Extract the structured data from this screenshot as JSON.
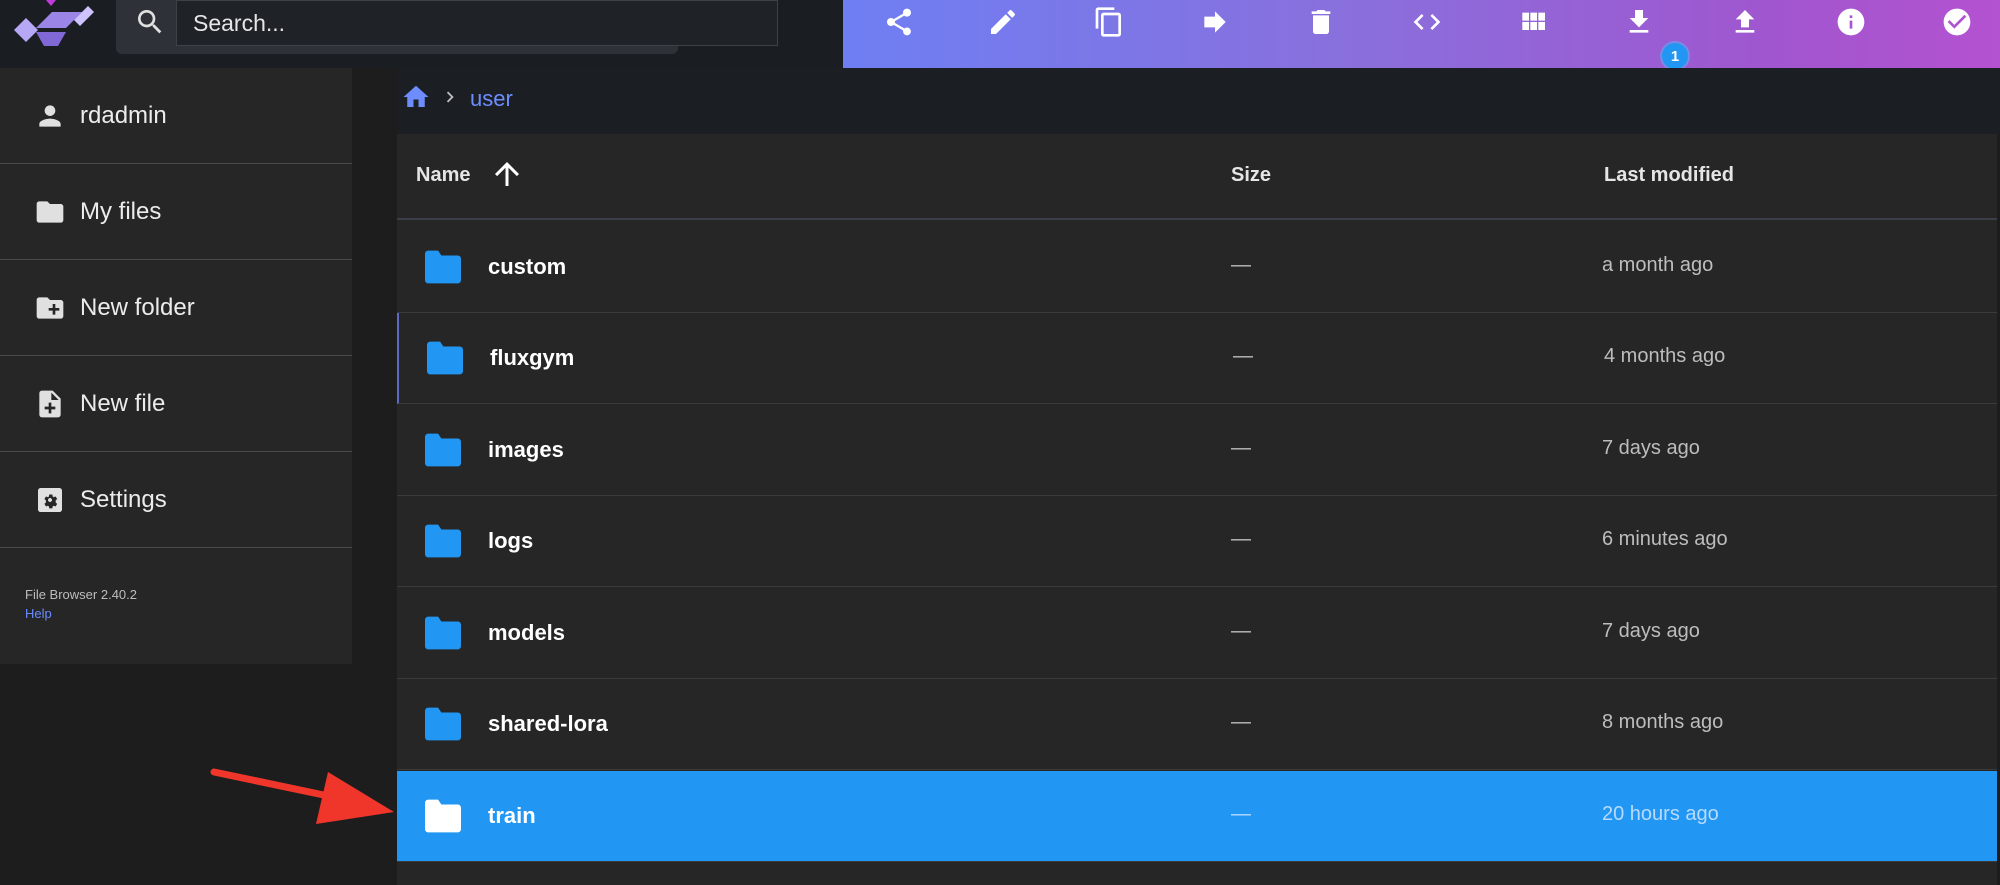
{
  "app": {
    "version": "File Browser 2.40.2",
    "help": "Help"
  },
  "search": {
    "placeholder": "Search..."
  },
  "toolbar": {
    "actions": [
      "share-icon",
      "edit-icon",
      "copy-icon",
      "move-icon",
      "delete-icon",
      "embed-code-icon",
      "grid-view-icon",
      "download-icon",
      "upload-icon",
      "info-icon",
      "select-all-icon"
    ],
    "download_badge": "1",
    "gradient": [
      "#6e7ff3",
      "#b452d0"
    ]
  },
  "sidebar": {
    "items": [
      {
        "label": "rdadmin",
        "icon": "person-icon"
      },
      {
        "label": "My files",
        "icon": "folder-icon"
      },
      {
        "label": "New folder",
        "icon": "new-folder-icon"
      },
      {
        "label": "New file",
        "icon": "new-file-icon"
      },
      {
        "label": "Settings",
        "icon": "settings-icon"
      }
    ]
  },
  "breadcrumb": {
    "home": "home-icon",
    "current": "user"
  },
  "listing": {
    "columns": {
      "name": "Name",
      "size": "Size",
      "modified": "Last modified"
    },
    "rows": [
      {
        "name": "custom",
        "size": "—",
        "modified": "a month ago"
      },
      {
        "name": "fluxgym",
        "size": "—",
        "modified": "4 months ago"
      },
      {
        "name": "images",
        "size": "—",
        "modified": "7 days ago"
      },
      {
        "name": "logs",
        "size": "—",
        "modified": "6 minutes ago"
      },
      {
        "name": "models",
        "size": "—",
        "modified": "7 days ago"
      },
      {
        "name": "shared-lora",
        "size": "—",
        "modified": "8 months ago"
      },
      {
        "name": "train",
        "size": "—",
        "modified": "20 hours ago",
        "selected": true
      }
    ]
  },
  "colors": {
    "accent": "#2196f3",
    "folder": "#2196f3",
    "annotation_arrow": "#f0362b"
  }
}
